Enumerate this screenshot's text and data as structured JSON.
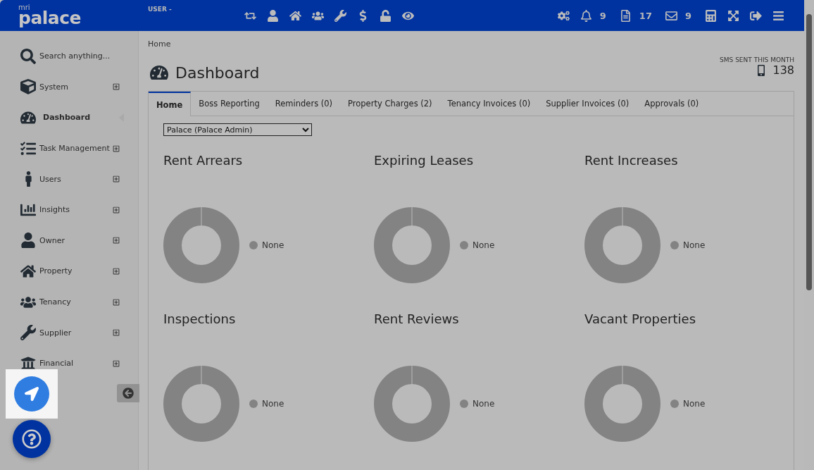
{
  "header": {
    "logo_small": "mri",
    "logo": "palace",
    "user": "USER -",
    "counters": [
      {
        "value": "9"
      },
      {
        "value": "17"
      },
      {
        "value": "9"
      }
    ]
  },
  "sidebar": {
    "search": {
      "placeholder": "Search anything..."
    },
    "items": [
      {
        "label": "System",
        "selected": false,
        "expanded": false
      },
      {
        "label": "Dashboard",
        "selected": true
      },
      {
        "label": "Task Management",
        "selected": false,
        "expanded": false
      },
      {
        "label": "Users",
        "selected": false,
        "expanded": false
      },
      {
        "label": "Insights",
        "selected": false,
        "expanded": false
      },
      {
        "label": "Owner",
        "selected": false,
        "expanded": false
      },
      {
        "label": "Property",
        "selected": false,
        "expanded": false
      },
      {
        "label": "Tenancy",
        "selected": false,
        "expanded": false
      },
      {
        "label": "Supplier",
        "selected": false,
        "expanded": false
      },
      {
        "label": "Financial",
        "selected": false,
        "expanded": false
      }
    ]
  },
  "breadcrumb": "Home",
  "page_title": "Dashboard",
  "sms": {
    "label": "SMS SENT THIS MONTH",
    "value": "138"
  },
  "tabs": [
    {
      "label": "Home",
      "selected": true
    },
    {
      "label": "Boss Reporting",
      "selected": false
    },
    {
      "label": "Reminders (0)",
      "selected": false
    },
    {
      "label": "Property Charges (2)",
      "selected": false
    },
    {
      "label": "Tenancy Invoices (0)",
      "selected": false
    },
    {
      "label": "Supplier Invoices (0)",
      "selected": false
    },
    {
      "label": "Approvals (0)",
      "selected": false
    }
  ],
  "portfolio_select": {
    "value": "Palace (Palace Admin)"
  },
  "cards": [
    {
      "title": "Rent Arrears",
      "legend": "None"
    },
    {
      "title": "Expiring Leases",
      "legend": "None"
    },
    {
      "title": "Rent Increases",
      "legend": "None"
    },
    {
      "title": "Inspections",
      "legend": "None"
    },
    {
      "title": "Rent Reviews",
      "legend": "None"
    },
    {
      "title": "Vacant Properties",
      "legend": "None"
    }
  ]
}
